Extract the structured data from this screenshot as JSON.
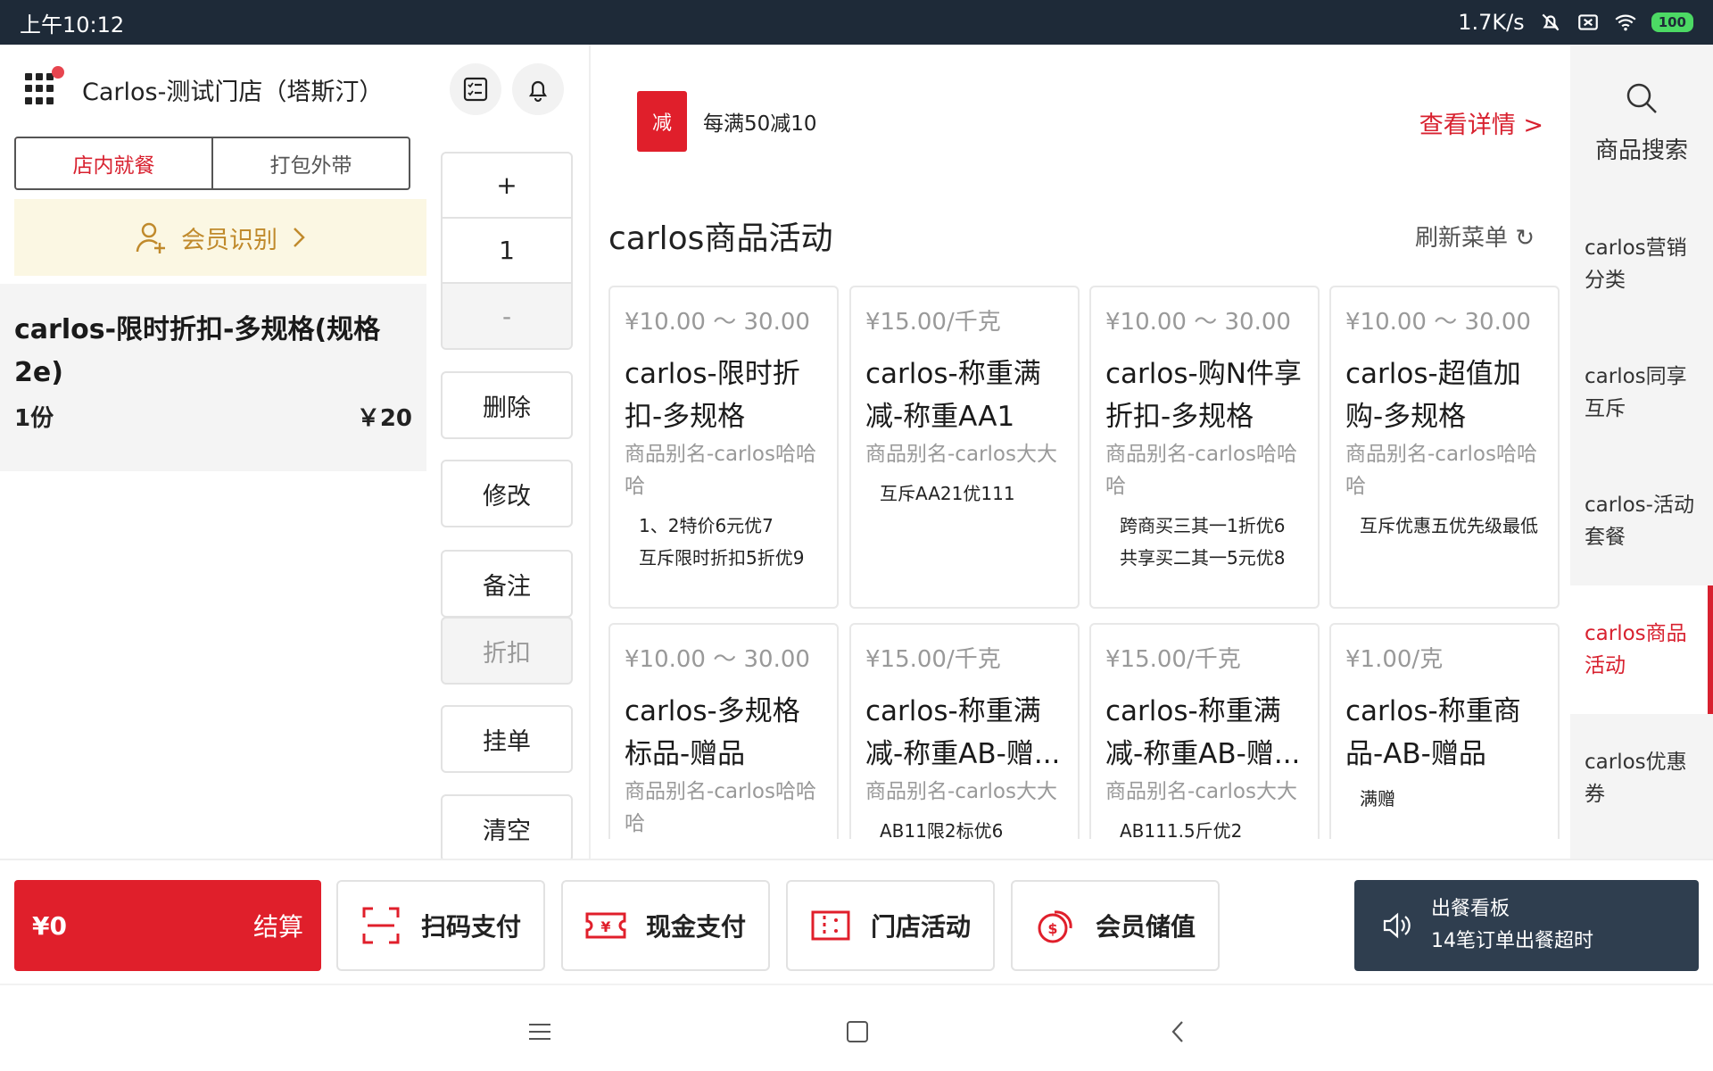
{
  "status_bar": {
    "time": "上午10:12",
    "network_speed": "1.7K/s",
    "battery": "100"
  },
  "header": {
    "store_name": "Carlos-测试门店（塔斯汀）"
  },
  "dine_toggle": {
    "options": [
      "店内就餐",
      "打包外带"
    ],
    "selected": "店内就餐"
  },
  "member": {
    "label": "会员识别"
  },
  "order": {
    "item_name": "carlos-限时折扣-多规格(规格2e)",
    "quantity_text": "1份",
    "price": "￥20"
  },
  "controls": {
    "plus": "+",
    "quantity": "1",
    "minus": "-",
    "delete": "删除",
    "modify": "修改",
    "note": "备注",
    "discount": "折扣",
    "hold": "挂单",
    "clear": "清空"
  },
  "promo": {
    "badge": "减",
    "text": "每满50减10",
    "link": "查看详情 >"
  },
  "section": {
    "title": "carlos商品活动",
    "refresh": "刷新菜单 ↻"
  },
  "products": [
    {
      "price": "¥10.00 ～ 30.00",
      "name": "carlos-限时折扣-多规格",
      "alias": "商品别名-carlos哈哈哈",
      "tags": [
        "1、2特价6元优7",
        "互斥限时折扣5折优9"
      ]
    },
    {
      "price": "¥15.00/千克",
      "name": "carlos-称重满减-称重AA1",
      "alias": "商品别名-carlos大大",
      "tags": [
        "互斥AA21优111"
      ]
    },
    {
      "price": "¥10.00 ～ 30.00",
      "name": "carlos-购N件享折扣-多规格",
      "alias": "商品别名-carlos哈哈哈",
      "tags": [
        "跨商买三其一1折优6",
        "共享买二其一5元优8"
      ]
    },
    {
      "price": "¥10.00 ～ 30.00",
      "name": "carlos-超值加购-多规格",
      "alias": "商品别名-carlos哈哈哈",
      "tags": [
        "互斥优惠五优先级最低"
      ]
    },
    {
      "price": "¥10.00 ～ 30.00",
      "name": "carlos-多规格标品-赠品",
      "alias": "商品别名-carlos哈哈哈",
      "tags": []
    },
    {
      "price": "¥15.00/千克",
      "name": "carlos-称重满减-称重AB-赠...",
      "alias": "商品别名-carlos大大",
      "tags": [
        "AB11限2标优6"
      ]
    },
    {
      "price": "¥15.00/千克",
      "name": "carlos-称重满减-称重AB-赠...",
      "alias": "商品别名-carlos大大",
      "tags": [
        "AB111.5斤优2"
      ]
    },
    {
      "price": "¥1.00/克",
      "name": "carlos-称重商品-AB-赠品",
      "alias": "",
      "tags": [
        "满赠"
      ]
    }
  ],
  "rail": {
    "search": "商品搜索",
    "categories": [
      "carlos营销分类",
      "carlos同享互斥",
      "carlos-活动套餐",
      "carlos商品活动",
      "carlos优惠券"
    ],
    "active": "carlos商品活动"
  },
  "bottom": {
    "amount": "¥0",
    "checkout": "结算",
    "scan_pay": "扫码支付",
    "cash_pay": "现金支付",
    "store_activity": "门店活动",
    "member_recharge": "会员储值",
    "board_title": "出餐看板",
    "board_sub": "14笔订单出餐超时"
  },
  "colors": {
    "accent_red": "#e01f2b",
    "member_gold": "#c08a2c",
    "dark_status": "#1e2a38",
    "board_bg": "#2f3e4f"
  }
}
